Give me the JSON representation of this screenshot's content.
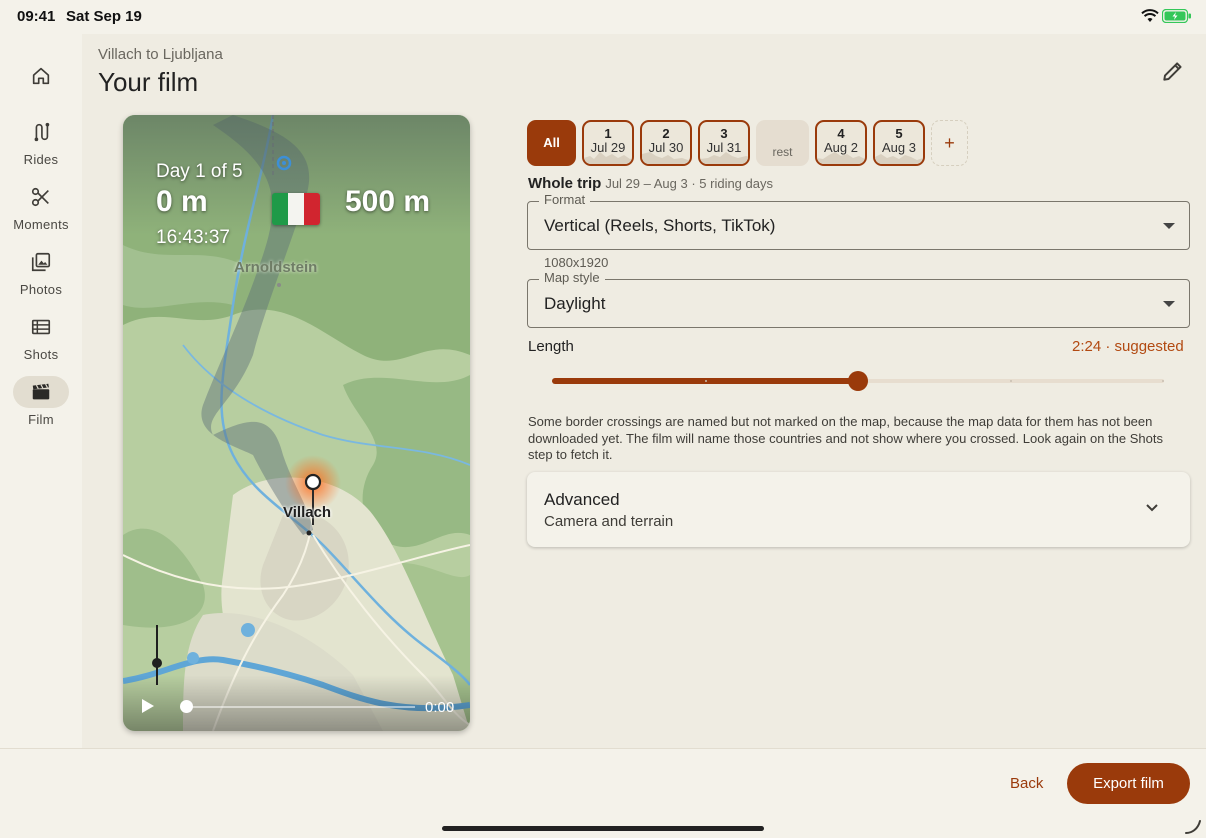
{
  "status": {
    "time": "09:41",
    "date": "Sat Sep 19"
  },
  "sidebar": {
    "items": [
      {
        "label": "",
        "icon": "home-icon"
      },
      {
        "label": "Rides",
        "icon": "route-icon"
      },
      {
        "label": "Moments",
        "icon": "scissors-icon"
      },
      {
        "label": "Photos",
        "icon": "photo-library-icon"
      },
      {
        "label": "Shots",
        "icon": "list-icon"
      },
      {
        "label": "Film",
        "icon": "clapperboard-icon",
        "active": true
      }
    ]
  },
  "header": {
    "subtitle": "Villach to Ljubljana",
    "title": "Your film"
  },
  "preview": {
    "day_label": "Day 1 of 5",
    "distance_left": "0 m",
    "distance_right": "500 m",
    "clock": "16:43:37",
    "town_label": "Arnoldstein",
    "place_label": "Villach",
    "time_readout": "0:00",
    "playback_fraction": 0,
    "flag_colors": [
      "#1f9a48",
      "#f4f4f0",
      "#d1252f"
    ]
  },
  "days": {
    "all_label": "All",
    "chips": [
      {
        "num": "1",
        "date": "Jul 29",
        "type": "day"
      },
      {
        "num": "2",
        "date": "Jul 30",
        "type": "day"
      },
      {
        "num": "3",
        "date": "Jul 31",
        "type": "day"
      },
      {
        "num": "",
        "date": "rest",
        "type": "rest"
      },
      {
        "num": "4",
        "date": "Aug 2",
        "type": "day"
      },
      {
        "num": "5",
        "date": "Aug 3",
        "type": "day"
      }
    ],
    "add_label": "+"
  },
  "trip": {
    "label": "Whole trip",
    "detail": "Jul 29 – Aug 3 · 5 riding days"
  },
  "format": {
    "legend": "Format",
    "value": "Vertical (Reels, Shorts, TikTok)",
    "helper": "1080x1920"
  },
  "map_style": {
    "legend": "Map style",
    "value": "Daylight"
  },
  "length": {
    "label": "Length",
    "suggestion": "2:24 · suggested",
    "slider_fraction": 0.5
  },
  "note": "Some border crossings are named but not marked on the map, because the map data for them has not been downloaded yet. The film will name those countries and not show where you crossed. Look again on the Shots step to fetch it.",
  "advanced": {
    "title": "Advanced",
    "subtitle": "Camera and terrain"
  },
  "actions": {
    "back": "Back",
    "export": "Export film"
  },
  "colors": {
    "accent": "#9a3a0b",
    "background": "#efece2",
    "panel": "#f4f2ea"
  }
}
